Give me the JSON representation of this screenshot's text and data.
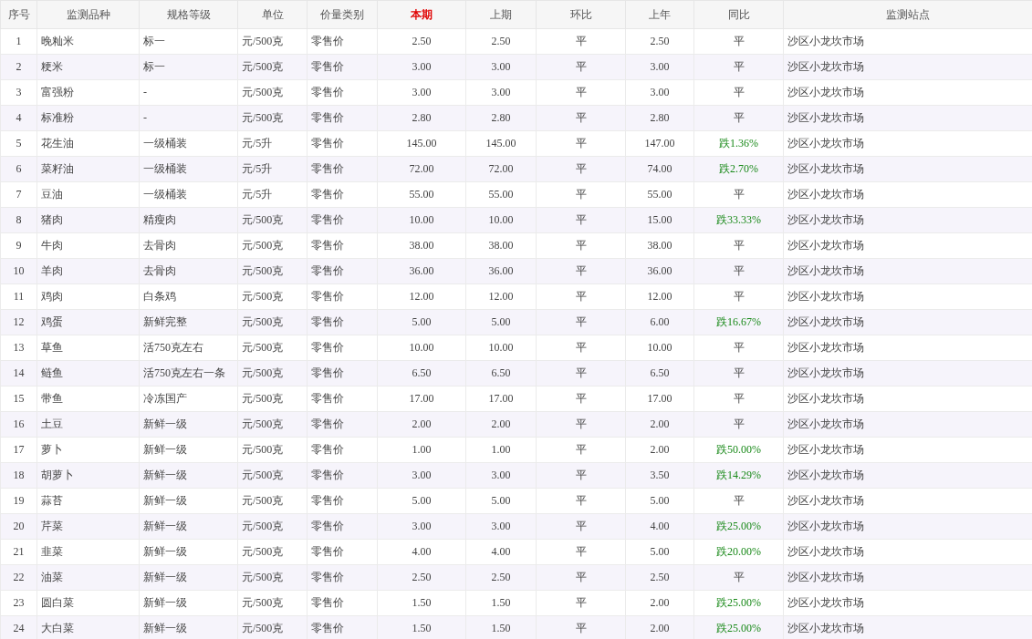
{
  "table": {
    "columns": [
      {
        "label": "序号",
        "emphasized": false
      },
      {
        "label": "监测品种",
        "emphasized": false
      },
      {
        "label": "规格等级",
        "emphasized": false
      },
      {
        "label": "单位",
        "emphasized": false
      },
      {
        "label": "价量类别",
        "emphasized": false
      },
      {
        "label": "本期",
        "emphasized": true
      },
      {
        "label": "上期",
        "emphasized": false
      },
      {
        "label": "环比",
        "emphasized": false
      },
      {
        "label": "上年",
        "emphasized": false
      },
      {
        "label": "同比",
        "emphasized": false
      },
      {
        "label": "监测站点",
        "emphasized": false
      }
    ],
    "rows": [
      {
        "no": "1",
        "item": "晚籼米",
        "spec": "标一",
        "unit": "元/500克",
        "price_type": "零售价",
        "current": "2.50",
        "previous": "2.50",
        "mom": "平",
        "last_year": "2.50",
        "yoy": {
          "text": "平",
          "kind": "flat"
        },
        "station": "沙区小龙坎市场"
      },
      {
        "no": "2",
        "item": "粳米",
        "spec": "标一",
        "unit": "元/500克",
        "price_type": "零售价",
        "current": "3.00",
        "previous": "3.00",
        "mom": "平",
        "last_year": "3.00",
        "yoy": {
          "text": "平",
          "kind": "flat"
        },
        "station": "沙区小龙坎市场"
      },
      {
        "no": "3",
        "item": "富强粉",
        "spec": "-",
        "unit": "元/500克",
        "price_type": "零售价",
        "current": "3.00",
        "previous": "3.00",
        "mom": "平",
        "last_year": "3.00",
        "yoy": {
          "text": "平",
          "kind": "flat"
        },
        "station": "沙区小龙坎市场"
      },
      {
        "no": "4",
        "item": "标准粉",
        "spec": "-",
        "unit": "元/500克",
        "price_type": "零售价",
        "current": "2.80",
        "previous": "2.80",
        "mom": "平",
        "last_year": "2.80",
        "yoy": {
          "text": "平",
          "kind": "flat"
        },
        "station": "沙区小龙坎市场"
      },
      {
        "no": "5",
        "item": "花生油",
        "spec": "一级桶装",
        "unit": "元/5升",
        "price_type": "零售价",
        "current": "145.00",
        "previous": "145.00",
        "mom": "平",
        "last_year": "147.00",
        "yoy": {
          "text": "跌1.36%",
          "kind": "down"
        },
        "station": "沙区小龙坎市场"
      },
      {
        "no": "6",
        "item": "菜籽油",
        "spec": "一级桶装",
        "unit": "元/5升",
        "price_type": "零售价",
        "current": "72.00",
        "previous": "72.00",
        "mom": "平",
        "last_year": "74.00",
        "yoy": {
          "text": "跌2.70%",
          "kind": "down"
        },
        "station": "沙区小龙坎市场"
      },
      {
        "no": "7",
        "item": "豆油",
        "spec": "一级桶装",
        "unit": "元/5升",
        "price_type": "零售价",
        "current": "55.00",
        "previous": "55.00",
        "mom": "平",
        "last_year": "55.00",
        "yoy": {
          "text": "平",
          "kind": "flat"
        },
        "station": "沙区小龙坎市场"
      },
      {
        "no": "8",
        "item": "猪肉",
        "spec": "精瘦肉",
        "unit": "元/500克",
        "price_type": "零售价",
        "current": "10.00",
        "previous": "10.00",
        "mom": "平",
        "last_year": "15.00",
        "yoy": {
          "text": "跌33.33%",
          "kind": "down"
        },
        "station": "沙区小龙坎市场"
      },
      {
        "no": "9",
        "item": "牛肉",
        "spec": "去骨肉",
        "unit": "元/500克",
        "price_type": "零售价",
        "current": "38.00",
        "previous": "38.00",
        "mom": "平",
        "last_year": "38.00",
        "yoy": {
          "text": "平",
          "kind": "flat"
        },
        "station": "沙区小龙坎市场"
      },
      {
        "no": "10",
        "item": "羊肉",
        "spec": "去骨肉",
        "unit": "元/500克",
        "price_type": "零售价",
        "current": "36.00",
        "previous": "36.00",
        "mom": "平",
        "last_year": "36.00",
        "yoy": {
          "text": "平",
          "kind": "flat"
        },
        "station": "沙区小龙坎市场"
      },
      {
        "no": "11",
        "item": "鸡肉",
        "spec": "白条鸡",
        "unit": "元/500克",
        "price_type": "零售价",
        "current": "12.00",
        "previous": "12.00",
        "mom": "平",
        "last_year": "12.00",
        "yoy": {
          "text": "平",
          "kind": "flat"
        },
        "station": "沙区小龙坎市场"
      },
      {
        "no": "12",
        "item": "鸡蛋",
        "spec": "新鲜完整",
        "unit": "元/500克",
        "price_type": "零售价",
        "current": "5.00",
        "previous": "5.00",
        "mom": "平",
        "last_year": "6.00",
        "yoy": {
          "text": "跌16.67%",
          "kind": "down"
        },
        "station": "沙区小龙坎市场"
      },
      {
        "no": "13",
        "item": "草鱼",
        "spec": "活750克左右",
        "unit": "元/500克",
        "price_type": "零售价",
        "current": "10.00",
        "previous": "10.00",
        "mom": "平",
        "last_year": "10.00",
        "yoy": {
          "text": "平",
          "kind": "flat"
        },
        "station": "沙区小龙坎市场"
      },
      {
        "no": "14",
        "item": "鲢鱼",
        "spec": "活750克左右一条",
        "unit": "元/500克",
        "price_type": "零售价",
        "current": "6.50",
        "previous": "6.50",
        "mom": "平",
        "last_year": "6.50",
        "yoy": {
          "text": "平",
          "kind": "flat"
        },
        "station": "沙区小龙坎市场"
      },
      {
        "no": "15",
        "item": "带鱼",
        "spec": "冷冻国产",
        "unit": "元/500克",
        "price_type": "零售价",
        "current": "17.00",
        "previous": "17.00",
        "mom": "平",
        "last_year": "17.00",
        "yoy": {
          "text": "平",
          "kind": "flat"
        },
        "station": "沙区小龙坎市场"
      },
      {
        "no": "16",
        "item": "土豆",
        "spec": "新鲜一级",
        "unit": "元/500克",
        "price_type": "零售价",
        "current": "2.00",
        "previous": "2.00",
        "mom": "平",
        "last_year": "2.00",
        "yoy": {
          "text": "平",
          "kind": "flat"
        },
        "station": "沙区小龙坎市场"
      },
      {
        "no": "17",
        "item": "萝卜",
        "spec": "新鲜一级",
        "unit": "元/500克",
        "price_type": "零售价",
        "current": "1.00",
        "previous": "1.00",
        "mom": "平",
        "last_year": "2.00",
        "yoy": {
          "text": "跌50.00%",
          "kind": "down"
        },
        "station": "沙区小龙坎市场"
      },
      {
        "no": "18",
        "item": "胡萝卜",
        "spec": "新鲜一级",
        "unit": "元/500克",
        "price_type": "零售价",
        "current": "3.00",
        "previous": "3.00",
        "mom": "平",
        "last_year": "3.50",
        "yoy": {
          "text": "跌14.29%",
          "kind": "down"
        },
        "station": "沙区小龙坎市场"
      },
      {
        "no": "19",
        "item": "蒜苔",
        "spec": "新鲜一级",
        "unit": "元/500克",
        "price_type": "零售价",
        "current": "5.00",
        "previous": "5.00",
        "mom": "平",
        "last_year": "5.00",
        "yoy": {
          "text": "平",
          "kind": "flat"
        },
        "station": "沙区小龙坎市场"
      },
      {
        "no": "20",
        "item": "芹菜",
        "spec": "新鲜一级",
        "unit": "元/500克",
        "price_type": "零售价",
        "current": "3.00",
        "previous": "3.00",
        "mom": "平",
        "last_year": "4.00",
        "yoy": {
          "text": "跌25.00%",
          "kind": "down"
        },
        "station": "沙区小龙坎市场"
      },
      {
        "no": "21",
        "item": "韭菜",
        "spec": "新鲜一级",
        "unit": "元/500克",
        "price_type": "零售价",
        "current": "4.00",
        "previous": "4.00",
        "mom": "平",
        "last_year": "5.00",
        "yoy": {
          "text": "跌20.00%",
          "kind": "down"
        },
        "station": "沙区小龙坎市场"
      },
      {
        "no": "22",
        "item": "油菜",
        "spec": "新鲜一级",
        "unit": "元/500克",
        "price_type": "零售价",
        "current": "2.50",
        "previous": "2.50",
        "mom": "平",
        "last_year": "2.50",
        "yoy": {
          "text": "平",
          "kind": "flat"
        },
        "station": "沙区小龙坎市场"
      },
      {
        "no": "23",
        "item": "圆白菜",
        "spec": "新鲜一级",
        "unit": "元/500克",
        "price_type": "零售价",
        "current": "1.50",
        "previous": "1.50",
        "mom": "平",
        "last_year": "2.00",
        "yoy": {
          "text": "跌25.00%",
          "kind": "down"
        },
        "station": "沙区小龙坎市场"
      },
      {
        "no": "24",
        "item": "大白菜",
        "spec": "新鲜一级",
        "unit": "元/500克",
        "price_type": "零售价",
        "current": "1.50",
        "previous": "1.50",
        "mom": "平",
        "last_year": "2.00",
        "yoy": {
          "text": "跌25.00%",
          "kind": "down"
        },
        "station": "沙区小龙坎市场"
      }
    ]
  }
}
